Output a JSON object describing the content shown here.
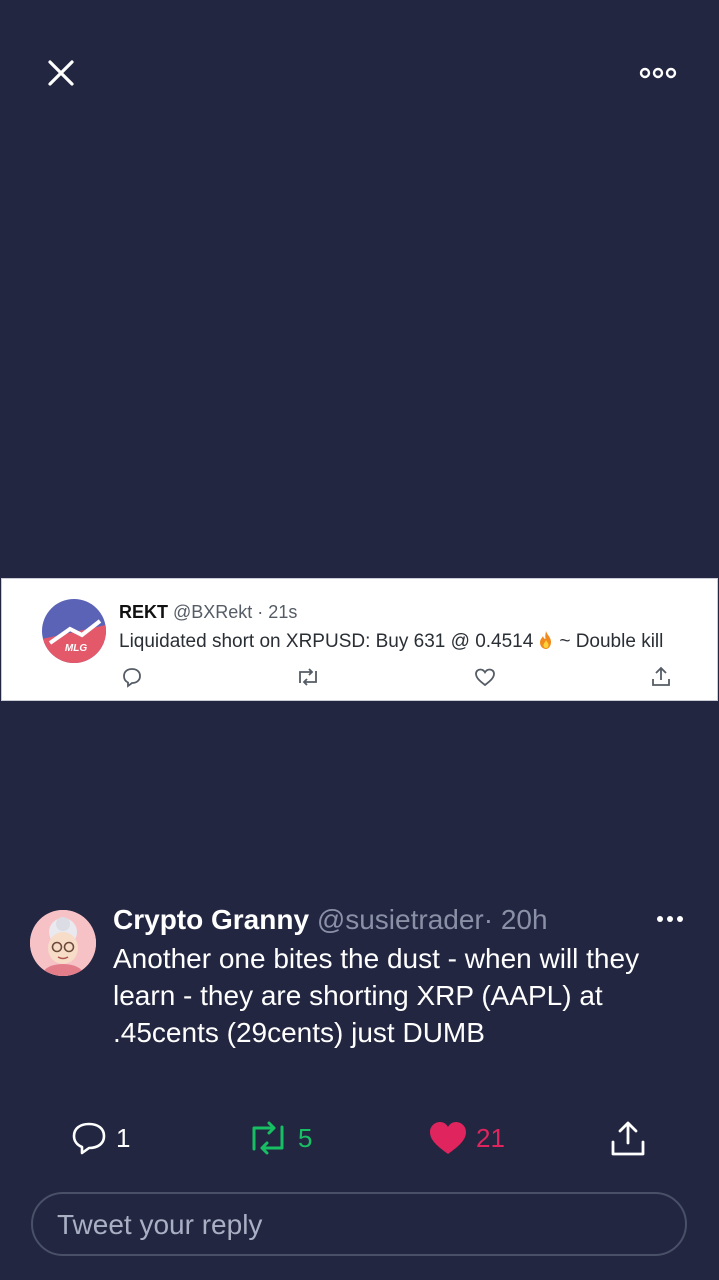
{
  "toolbar": {
    "close_icon": "close-icon",
    "more_icon": "more-horizontal-icon"
  },
  "embedded_tweet": {
    "name": "REKT",
    "handle_time": "@BXRekt · 21s",
    "text_before": "Liquidated short on XRPUSD: Buy 631 @ 0.4514",
    "text_after": "~ Double kill",
    "avatar_text": "MLG",
    "icons": [
      "reply-icon",
      "retweet-icon",
      "like-icon",
      "share-icon"
    ]
  },
  "tweet": {
    "name": "Crypto Granny",
    "handle": "@susietrader",
    "time": "· 20h",
    "body": "Another one bites the dust - when will they learn - they are shorting XRP (AAPL) at .45cents (29cents) just DUMB",
    "replies": "1",
    "retweets": "5",
    "likes": "21"
  },
  "reply": {
    "placeholder": "Tweet your reply"
  },
  "colors": {
    "background": "#222641",
    "retweet": "#17bf63",
    "like": "#e0245e",
    "muted": "#8a90a6"
  }
}
